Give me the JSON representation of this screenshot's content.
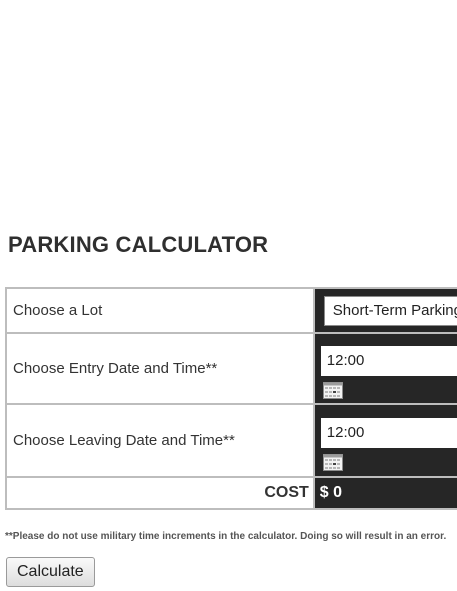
{
  "page": {
    "title": "PARKING CALCULATOR"
  },
  "form": {
    "lot_label": "Choose a Lot",
    "lot_value": "Short-Term Parking",
    "entry_label": "Choose Entry Date and Time**",
    "entry_time": "12:00",
    "leaving_label": "Choose Leaving Date and Time**",
    "leaving_time": "12:00",
    "calendar_icon": "calendar-icon",
    "cost_label": "COST",
    "cost_value": "$ 0"
  },
  "footnote": "**Please do not use military time increments in the calculator.  Doing so will result in an error.",
  "actions": {
    "calculate_label": "Calculate"
  },
  "colors": {
    "value_cell_background": "#262626",
    "border": "#bdbdbd",
    "text": "#333333"
  }
}
